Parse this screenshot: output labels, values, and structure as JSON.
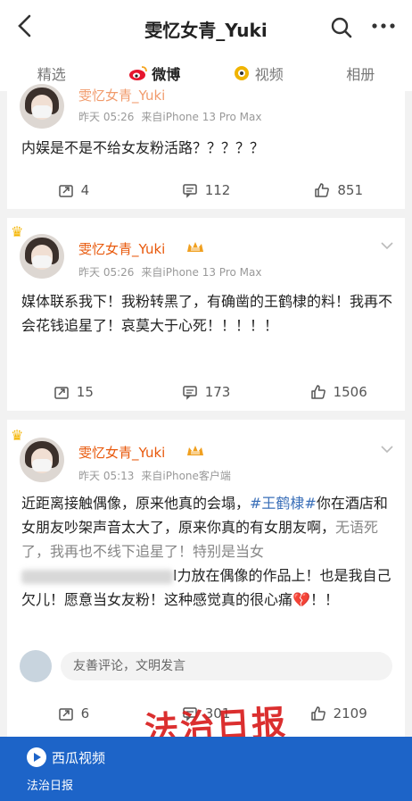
{
  "header": {
    "title": "雯忆女青_Yuki",
    "back_icon": "chevron-left-icon",
    "search_icon": "search-icon",
    "more_icon": "more-icon"
  },
  "tabs": [
    {
      "label": "精选",
      "active": false
    },
    {
      "label": "微博",
      "active": true,
      "icon": "weibo-icon"
    },
    {
      "label": "视频",
      "active": false,
      "icon": "video-icon"
    },
    {
      "label": "相册",
      "active": false
    }
  ],
  "posts": [
    {
      "name": "雯忆女青_Yuki",
      "time": "昨天 05:26",
      "source": "来自iPhone 13 Pro Max",
      "text": "内娱是不是不给女友粉活路？？？？？",
      "reposts": "4",
      "comments": "112",
      "likes": "851"
    },
    {
      "name": "雯忆女青_Yuki",
      "time": "昨天 05:26",
      "source": "来自iPhone 13 Pro Max",
      "text": "媒体联系我下！我粉转黑了，有确凿的王鹤棣的料！我再不会花钱追星了！哀莫大于心死！！！！！",
      "reposts": "15",
      "comments": "173",
      "likes": "1506"
    },
    {
      "name": "雯忆女青_Yuki",
      "time": "昨天 05:13",
      "source": "来自iPhone客户端",
      "line1_a": "近距离接触偶像，原来他真的会塌，",
      "hashtag": "#王鹤棣#",
      "line1_b": "你在酒店和女朋友吵架声音太大了，原来你真的有女朋友啊，",
      "line2_partial": "无语死了，我再也不线下追星了！特别是当女",
      "line3_tail": "l力放在偶像的作品上！也是我自己欠儿！愿意当女友粉！这种感觉真的很心痛",
      "line_end": "！！",
      "comment_placeholder": "友善评论，文明发言",
      "reposts": "6",
      "comments": "301",
      "likes": "2109"
    }
  ],
  "watermark": "法治日报",
  "bottom": {
    "app": "西瓜视频",
    "source": "法治日报"
  },
  "colors": {
    "name": "#e8590c",
    "hashtag": "#3a6fb8",
    "bottom_bar": "#1d64c8",
    "watermark": "#d81e1e"
  }
}
